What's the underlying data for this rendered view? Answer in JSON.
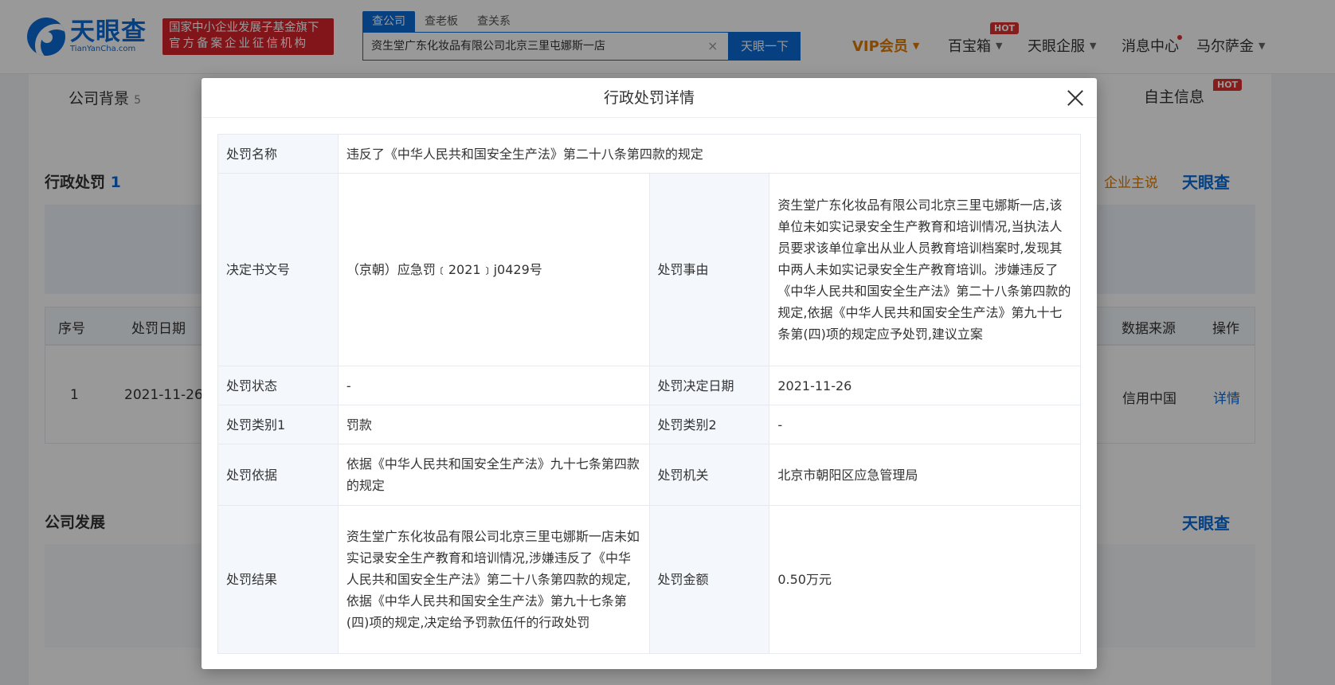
{
  "header": {
    "logo_cn": "天眼查",
    "logo_en": "TianYanCha.com",
    "badge_line1": "国家中小企业发展子基金旗下",
    "badge_line2": "官方备案企业征信机构",
    "search_tabs": [
      "查公司",
      "查老板",
      "查关系"
    ],
    "search_value": "资生堂广东化妆品有限公司北京三里屯娜斯一店",
    "search_clear": "×",
    "search_button": "天眼一下",
    "nav": {
      "vip": "VIP会员",
      "treasure": "百宝箱",
      "treasure_hot": "HOT",
      "service": "天眼企服",
      "messages": "消息中心",
      "user": "马尔萨金"
    }
  },
  "background": {
    "tab_company": "公司背景",
    "tab_company_count": "5",
    "tab_self_info": "自主信息",
    "tab_self_info_hot": "HOT",
    "section_penalty": "行政处罚",
    "section_penalty_count": "1",
    "enterprise_says": "企业主说",
    "watermark": "天眼查",
    "table_headers": {
      "index": "序号",
      "date": "处罚日期",
      "source": "数据来源",
      "action": "操作"
    },
    "row": {
      "index": "1",
      "date": "2021-11-26",
      "source": "信用中国",
      "action": "详情"
    },
    "section_development": "公司发展",
    "watermark2": "天眼查"
  },
  "modal": {
    "title": "行政处罚详情",
    "rows": {
      "name_label": "处罚名称",
      "name_value": "违反了《中华人民共和国安全生产法》第二十八条第四款的规定",
      "doc_label": "决定书文号",
      "doc_value": "（京朝）应急罚﹝2021﹞j0429号",
      "reason_label": "处罚事由",
      "reason_value": "资生堂广东化妆品有限公司北京三里屯娜斯一店,该单位未如实记录安全生产教育和培训情况,当执法人员要求该单位拿出从业人员教育培训档案时,发现其中两人未如实记录安全生产教育培训。涉嫌违反了《中华人民共和国安全生产法》第二十八条第四款的规定,依据《中华人民共和国安全生产法》第九十七条第(四)项的规定应予处罚,建议立案",
      "status_label": "处罚状态",
      "status_value": "-",
      "date_label": "处罚决定日期",
      "date_value": "2021-11-26",
      "cat1_label": "处罚类别1",
      "cat1_value": "罚款",
      "cat2_label": "处罚类别2",
      "cat2_value": "-",
      "basis_label": "处罚依据",
      "basis_value": "依据《中华人民共和国安全生产法》九十七条第四款的规定",
      "authority_label": "处罚机关",
      "authority_value": "北京市朝阳区应急管理局",
      "result_label": "处罚结果",
      "result_value": "资生堂广东化妆品有限公司北京三里屯娜斯一店未如实记录安全生产教育和培训情况,涉嫌违反了《中华人民共和国安全生产法》第二十八条第四款的规定,依据《中华人民共和国安全生产法》第九十七条第(四)项的规定,决定给予罚款伍仟的行政处罚",
      "amount_label": "处罚金额",
      "amount_value": "0.50万元"
    }
  }
}
